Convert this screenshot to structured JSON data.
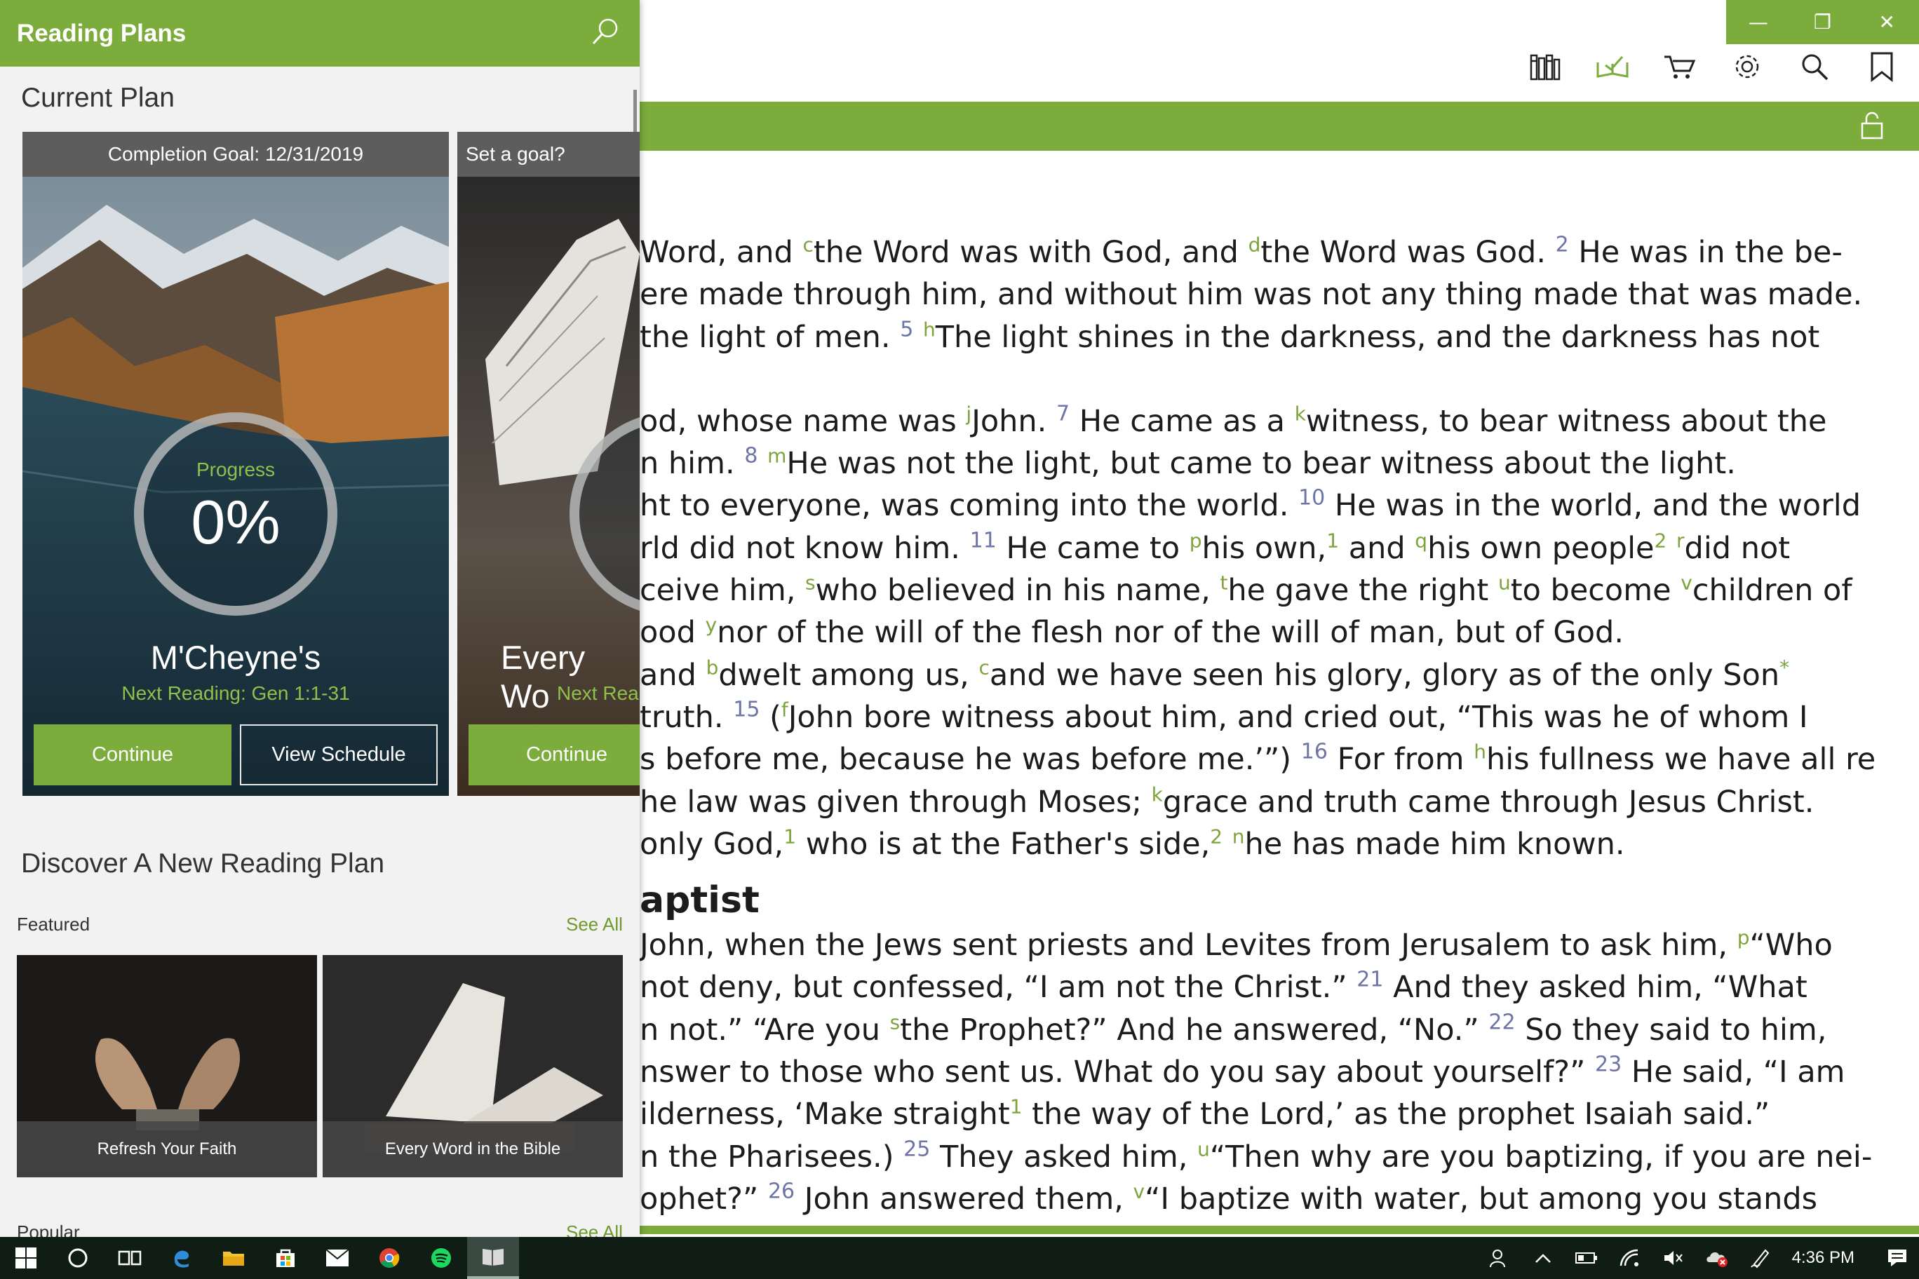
{
  "window": {
    "minimize": "—",
    "restore": "❐",
    "close": "✕"
  },
  "toolbar": {
    "icons": [
      "library-icon",
      "reading-plans-icon",
      "cart-icon",
      "settings-icon",
      "search-icon",
      "bookmark-icon"
    ]
  },
  "bible": {
    "lines": [
      [
        "Word, and ",
        {
          "fn": "c"
        },
        "the Word was with God, and ",
        {
          "fn": "d"
        },
        "the Word was God. ",
        {
          "vn": "2"
        },
        " He was in the be-"
      ],
      [
        "ere made through him, and without him was not any thing made that was made."
      ],
      [
        "the light of men. ",
        {
          "vn": "5"
        },
        " ",
        {
          "fn": "h"
        },
        "The light shines in the darkness, and the darkness has not"
      ],
      [],
      [
        "od, whose name was ",
        {
          "fn": "j"
        },
        "John. ",
        {
          "vn": "7"
        },
        " He came as a ",
        {
          "fn": "k"
        },
        "witness, to bear witness about the"
      ],
      [
        "n him. ",
        {
          "vn": "8"
        },
        " ",
        {
          "fn": "m"
        },
        "He was not the light, but came to bear witness about the light."
      ],
      [
        "ht to everyone, was coming into the world. ",
        {
          "vn": "10"
        },
        " He was in the world, and the world"
      ],
      [
        "rld did not know him. ",
        {
          "vn": "11"
        },
        " He came to ",
        {
          "fn": "p"
        },
        "his own,",
        {
          "fn": "1"
        },
        " and ",
        {
          "fn": "q"
        },
        "his own people",
        {
          "fn": "2"
        },
        " ",
        {
          "fn": "r"
        },
        "did not"
      ],
      [
        "ceive him, ",
        {
          "fn": "s"
        },
        "who believed in his name, ",
        {
          "fn": "t"
        },
        "he gave the right ",
        {
          "fn": "u"
        },
        "to become ",
        {
          "fn": "v"
        },
        "children of"
      ],
      [
        "ood ",
        {
          "fn": "y"
        },
        "nor of the will of the flesh nor of the will of man, but of God."
      ],
      [
        "and ",
        {
          "fn": "b"
        },
        "dwelt among us, ",
        {
          "fn": "c"
        },
        "and we have seen his glory, glory as of the only Son",
        {
          "fn": "*"
        }
      ],
      [
        "truth. ",
        {
          "vn": "15"
        },
        " (",
        {
          "fn": "f"
        },
        "John bore witness about him, and cried out, “This was he of whom I"
      ],
      [
        "s before me, because he was before me.’”) ",
        {
          "vn": "16"
        },
        " For from ",
        {
          "fn": "h"
        },
        "his fullness we have all re-"
      ],
      [
        "he law was given through Moses; ",
        {
          "fn": "k"
        },
        "grace and truth came through Jesus Christ."
      ],
      [
        "only God,",
        {
          "fn": "1"
        },
        " who is at the Father's side,",
        {
          "fn": "2"
        },
        " ",
        {
          "fn": "n"
        },
        "he has made him known."
      ]
    ],
    "heading": "aptist",
    "lines2": [
      [
        "John, when the Jews sent priests and Levites from Jerusalem to ask him, ",
        {
          "fn": "p"
        },
        "“Who"
      ],
      [
        "not deny, but confessed, “I am not the Christ.” ",
        {
          "vn": "21"
        },
        " And they asked him, “What"
      ],
      [
        "n not.” “Are you ",
        {
          "fn": "s"
        },
        "the Prophet?” And he answered, “No.” ",
        {
          "vn": "22"
        },
        " So they said to him,"
      ],
      [
        "nswer to those who sent us. What do you say about yourself?” ",
        {
          "vn": "23"
        },
        " He said, “I am"
      ],
      [
        "ilderness, ‘Make straight",
        {
          "fn": "1"
        },
        " the way of the Lord,’ as the prophet Isaiah said.”"
      ],
      [
        "n the Pharisees.) ",
        {
          "vn": "25"
        },
        " They asked him, ",
        {
          "fn": "u"
        },
        "“Then why are you baptizing, if you are nei-"
      ],
      [
        "ophet?” ",
        {
          "vn": "26"
        },
        " John answered them, ",
        {
          "fn": "v"
        },
        "“I baptize with water, but among you stands"
      ]
    ]
  },
  "pane": {
    "title": "Reading Plans",
    "current_plan": "Current Plan",
    "discover": "Discover A New Reading Plan",
    "featured": "Featured",
    "popular": "Popular",
    "see_all": "See All"
  },
  "plans": [
    {
      "top_label": "Completion Goal: 12/31/2019",
      "progress_label": "Progress",
      "progress_value": "0%",
      "progress_fraction": 0,
      "name": "M'Cheyne's",
      "next_reading": "Next Reading:  Gen 1:1-31",
      "continue": "Continue",
      "schedule": "View Schedule"
    },
    {
      "top_label": "Set a goal?",
      "name": "Every Wo",
      "next_reading": "Next Rea",
      "continue": "Continue"
    }
  ],
  "featured_tiles": [
    {
      "caption": "Refresh Your Faith"
    },
    {
      "caption": "Every Word in the Bible"
    }
  ],
  "taskbar": {
    "apps": [
      "windows-start-icon",
      "cortana-icon",
      "task-view-icon",
      "edge-icon",
      "file-explorer-icon",
      "store-icon",
      "mail-icon",
      "chrome-icon",
      "spotify-icon",
      "bible-app-icon"
    ],
    "clock": "4:36 PM"
  },
  "colors": {
    "accent": "#7cad3c",
    "accent_text": "#8fc04c",
    "verse_number": "#6d74a6",
    "footnote": "#7ea43c",
    "taskbar": "#101d15"
  }
}
